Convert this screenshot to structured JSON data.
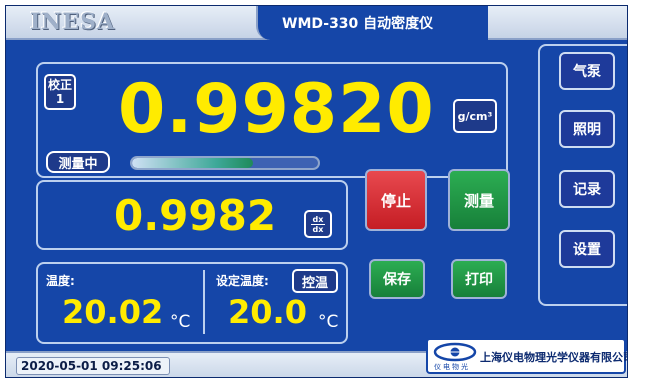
{
  "header": {
    "brand": "INESA",
    "title": "WMD-330 自动密度仪"
  },
  "main_panel": {
    "calibration_label": "校正\n1",
    "density_value": "0.99820",
    "unit_label": "g/cm³",
    "measuring_status": "测量中",
    "progress": 0.65,
    "secondary_value": "0.9982",
    "dx_top": "dx",
    "dx_bottom": "dx"
  },
  "temperature": {
    "label": "温度:",
    "value": "20.02",
    "unit": "°C",
    "set_label": "设定温度:",
    "set_value": "20.0",
    "set_unit": "°C",
    "control_button": "控温"
  },
  "actions": {
    "stop": "停止",
    "measure": "测量",
    "save": "保存",
    "print": "打印"
  },
  "sidebar": {
    "items": [
      {
        "label": "气泵"
      },
      {
        "label": "照明"
      },
      {
        "label": "记录"
      },
      {
        "label": "设置"
      }
    ]
  },
  "status_bar": {
    "datetime": "2020-05-01 09:25:06",
    "company_name": "上海仪电物理光学仪器有限公司",
    "company_logo_text": "仪电物光"
  },
  "colors": {
    "background": "#1546a8",
    "value_yellow": "#ffeb00",
    "stop_red": "#d2292f",
    "measure_green": "#1f9244"
  },
  "icons": {
    "company_logo": "eye-logo-icon"
  }
}
